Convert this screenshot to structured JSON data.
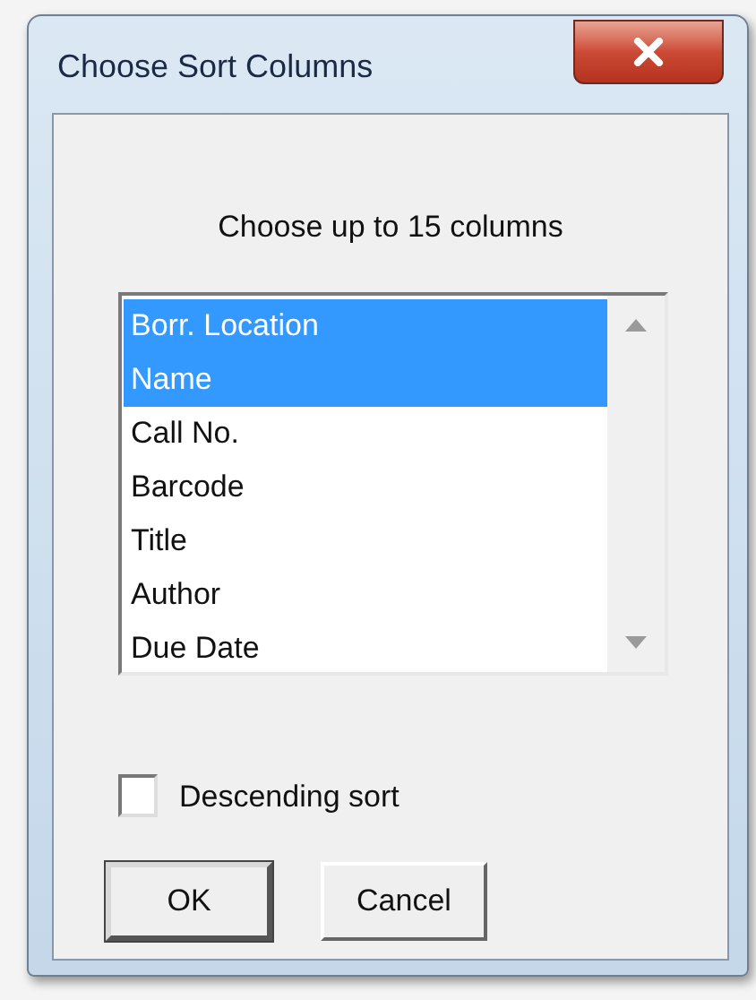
{
  "window": {
    "title": "Choose Sort Columns"
  },
  "instruction": "Choose up to 15 columns",
  "columns": [
    {
      "label": "Borr. Location",
      "selected": true
    },
    {
      "label": "Name",
      "selected": true
    },
    {
      "label": "Call No.",
      "selected": false
    },
    {
      "label": "Barcode",
      "selected": false
    },
    {
      "label": "Title",
      "selected": false
    },
    {
      "label": "Author",
      "selected": false
    },
    {
      "label": "Due Date",
      "selected": false
    }
  ],
  "descending_sort": {
    "label": "Descending sort",
    "checked": false
  },
  "buttons": [
    {
      "label": "OK",
      "default": true
    },
    {
      "label": "Cancel",
      "default": false
    }
  ]
}
